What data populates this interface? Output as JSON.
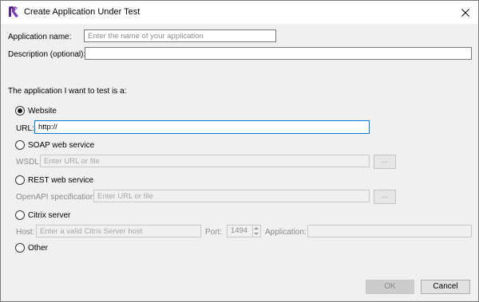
{
  "window": {
    "title": "Create Application Under Test",
    "app_icon": "ranorex-icon"
  },
  "application_name": {
    "label": "Application name:",
    "placeholder": "Enter the name of your application",
    "value": ""
  },
  "description": {
    "label": "Description (optional):",
    "value": ""
  },
  "section_label": "The application I want to test is a:",
  "options": {
    "website": {
      "label": "Website",
      "selected": true
    },
    "soap": {
      "label": "SOAP web service",
      "selected": false
    },
    "rest": {
      "label": "REST web service",
      "selected": false
    },
    "citrix": {
      "label": "Citrix server",
      "selected": false
    },
    "other": {
      "label": "Other",
      "selected": false
    }
  },
  "url": {
    "label": "URL:",
    "value": "http://"
  },
  "wsdl": {
    "label": "WSDL:",
    "placeholder": "Enter URL or file",
    "browse_label": "..."
  },
  "openapi": {
    "label": "OpenAPI specification:",
    "placeholder": "Enter URL or file",
    "browse_label": "..."
  },
  "citrix": {
    "host_label": "Host:",
    "host_placeholder": "Enter a valid Citrix Server host",
    "port_label": "Port:",
    "port_value": "1494",
    "application_label": "Application:",
    "application_value": ""
  },
  "buttons": {
    "ok": "OK",
    "cancel": "Cancel"
  },
  "colors": {
    "focus_border": "#0078d7",
    "disabled_text": "#8a8a8a"
  }
}
